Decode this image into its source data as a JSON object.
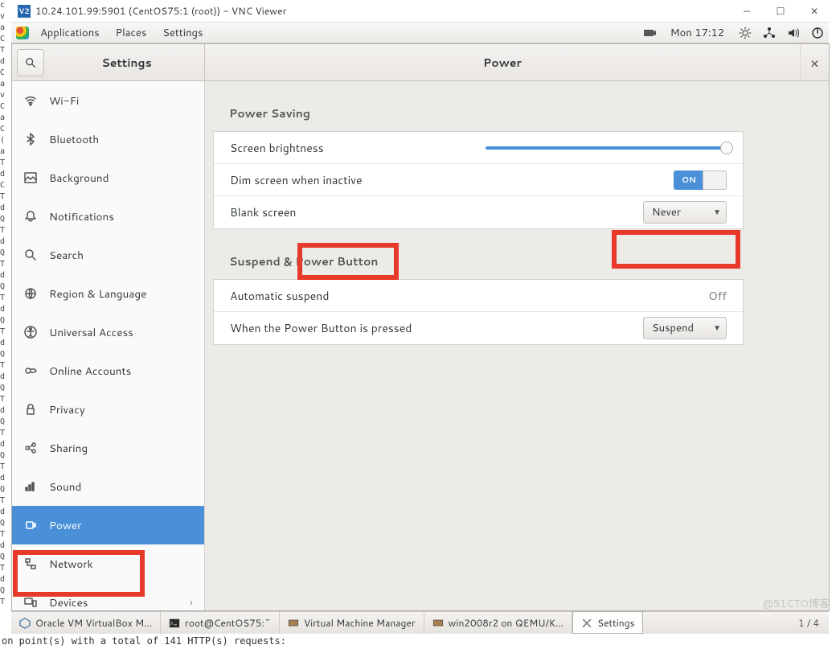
{
  "vnc": {
    "title": "10.24.101.99:5901 (CentOS75:1 (root)) - VNC Viewer",
    "icon_label": "V2"
  },
  "topbar": {
    "menus": [
      "Applications",
      "Places",
      "Settings"
    ],
    "clock": "Mon 17:12"
  },
  "header": {
    "back_title": "Settings",
    "page_title": "Power"
  },
  "sidebar": {
    "items": [
      {
        "key": "wifi",
        "label": "Wi-Fi"
      },
      {
        "key": "bluetooth",
        "label": "Bluetooth"
      },
      {
        "key": "background",
        "label": "Background"
      },
      {
        "key": "notifications",
        "label": "Notifications"
      },
      {
        "key": "search",
        "label": "Search"
      },
      {
        "key": "region",
        "label": "Region & Language"
      },
      {
        "key": "universal",
        "label": "Universal Access"
      },
      {
        "key": "online",
        "label": "Online Accounts"
      },
      {
        "key": "privacy",
        "label": "Privacy"
      },
      {
        "key": "sharing",
        "label": "Sharing"
      },
      {
        "key": "sound",
        "label": "Sound"
      },
      {
        "key": "power",
        "label": "Power",
        "selected": true
      },
      {
        "key": "network",
        "label": "Network"
      },
      {
        "key": "devices",
        "label": "Devices",
        "chevron": true
      }
    ]
  },
  "content": {
    "power_saving": {
      "title": "Power Saving",
      "brightness": {
        "label": "Screen brightness",
        "value": 100
      },
      "dim": {
        "label": "Dim screen when inactive",
        "state": "ON"
      },
      "blank": {
        "label": "Blank screen",
        "value": "Never"
      }
    },
    "suspend": {
      "title": "Suspend & Power Button",
      "auto": {
        "label": "Automatic suspend",
        "value": "Off"
      },
      "button": {
        "label": "When the Power Button is pressed",
        "value": "Suspend"
      }
    }
  },
  "taskbar": {
    "items": [
      {
        "label": "Oracle VM VirtualBox M..."
      },
      {
        "label": "root@CentOS75:~"
      },
      {
        "label": "Virtual Machine Manager"
      },
      {
        "label": "win2008r2 on QEMU/K..."
      },
      {
        "label": "Settings",
        "active": true
      }
    ],
    "workspace": "1 / 4"
  },
  "watermark": "@51CTO博客",
  "bottom_text": "on point(s) with a total of 141 HTTP(s) requests:"
}
